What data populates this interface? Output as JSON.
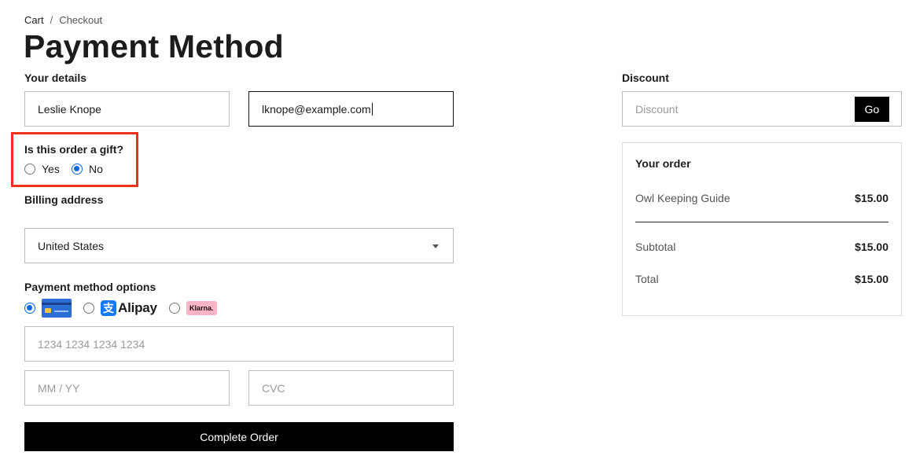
{
  "breadcrumb": {
    "items": [
      "Cart",
      "Checkout"
    ],
    "separator": "/"
  },
  "page_title": "Payment Method",
  "details": {
    "label": "Your details",
    "name_value": "Leslie Knope",
    "email_value": "lknope@example.com"
  },
  "gift": {
    "question": "Is this order a gift?",
    "options": [
      {
        "label": "Yes",
        "checked": false
      },
      {
        "label": "No",
        "checked": true
      }
    ]
  },
  "billing": {
    "label": "Billing address",
    "country_selected": "United States"
  },
  "payment": {
    "label": "Payment method options",
    "methods": [
      {
        "name": "card",
        "icon": "credit-card-icon",
        "checked": true
      },
      {
        "name": "Alipay",
        "icon": "alipay-logo",
        "checked": false
      },
      {
        "name": "Klarna.",
        "icon": "klarna-logo",
        "checked": false
      }
    ],
    "card_number_placeholder": "1234 1234 1234 1234",
    "expiry_placeholder": "MM / YY",
    "cvc_placeholder": "CVC",
    "submit_label": "Complete Order"
  },
  "discount": {
    "label": "Discount",
    "placeholder": "Discount",
    "go_label": "Go"
  },
  "order": {
    "heading": "Your order",
    "items": [
      {
        "name": "Owl Keeping Guide",
        "price": "$15.00"
      }
    ],
    "subtotal_label": "Subtotal",
    "subtotal_value": "$15.00",
    "total_label": "Total",
    "total_value": "$15.00"
  },
  "colors": {
    "highlight": "#f2311b",
    "radio_accent": "#0b66e4",
    "button_bg": "#000000"
  }
}
